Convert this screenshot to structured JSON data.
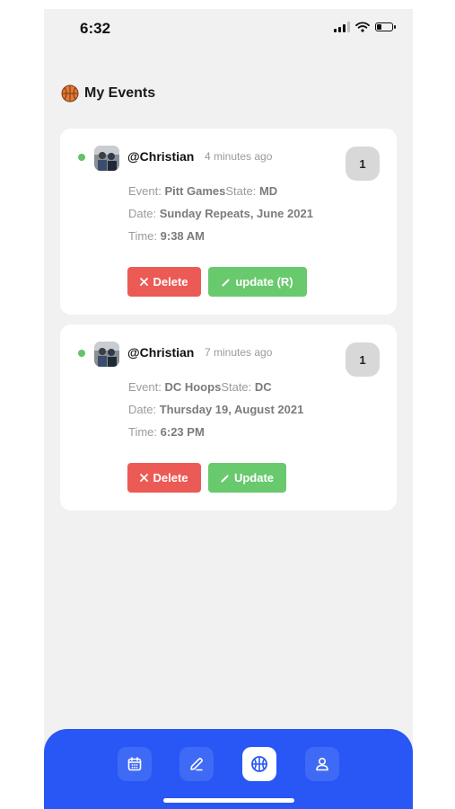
{
  "status_bar": {
    "time": "6:32"
  },
  "header": {
    "title": "My Events",
    "icon": "basketball-icon"
  },
  "events": [
    {
      "username": "@Christian",
      "time_ago": "4 minutes ago",
      "badge": "1",
      "event_label": "Event: ",
      "event_value": "Pitt Games",
      "state_label": "State: ",
      "state_value": "MD",
      "date_label": "Date: ",
      "date_value": "Sunday Repeats, June 2021",
      "time_label": "Time: ",
      "time_value": "9:38 AM",
      "delete_label": "Delete",
      "update_label": "update (R)"
    },
    {
      "username": "@Christian",
      "time_ago": "7 minutes ago",
      "badge": "1",
      "event_label": "Event: ",
      "event_value": "DC Hoops",
      "state_label": "State: ",
      "state_value": "DC",
      "date_label": "Date: ",
      "date_value": "Thursday 19, August 2021",
      "time_label": "Time: ",
      "time_value": "6:23 PM",
      "delete_label": "Delete",
      "update_label": "Update"
    }
  ],
  "tab_bar": {
    "tabs": [
      {
        "icon": "calendar-icon",
        "active": false
      },
      {
        "icon": "pencil-icon",
        "active": false
      },
      {
        "icon": "basketball-icon",
        "active": true
      },
      {
        "icon": "user-icon",
        "active": false
      }
    ]
  },
  "colors": {
    "accent": "#2957f5",
    "delete": "#ec5a56",
    "update": "#68c96d",
    "online": "#62c36a",
    "background": "#f1f1f2"
  }
}
